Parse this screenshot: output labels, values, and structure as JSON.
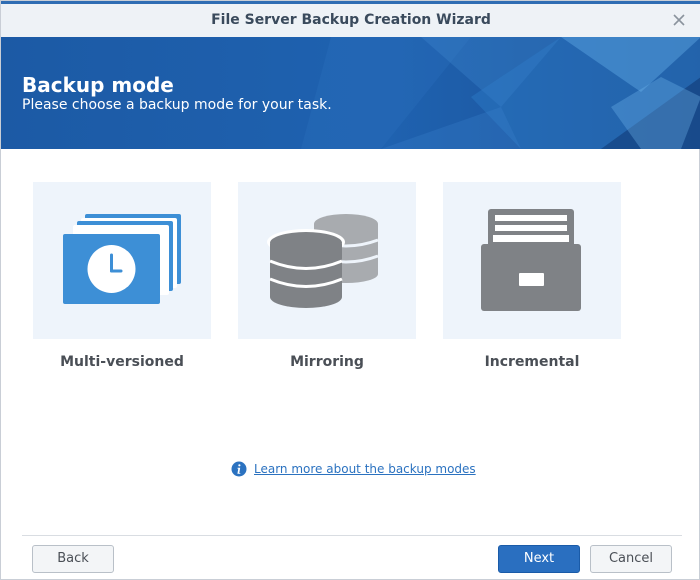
{
  "window": {
    "title": "File Server Backup Creation Wizard",
    "close_icon": "close-icon"
  },
  "header": {
    "title": "Backup mode",
    "subtitle": "Please choose a backup mode for your task."
  },
  "options": [
    {
      "label": "Multi-versioned",
      "icon": "stacked-versions-clock-icon"
    },
    {
      "label": "Mirroring",
      "icon": "database-stack-icon"
    },
    {
      "label": "Incremental",
      "icon": "file-cabinet-icon"
    }
  ],
  "info": {
    "icon": "info-icon",
    "link_text": "Learn more about the backup modes"
  },
  "footer": {
    "back_label": "Back",
    "next_label": "Next",
    "cancel_label": "Cancel"
  },
  "colors": {
    "accent": "#2a6fc0",
    "banner": "#1e5ba6",
    "option_bg": "#eef4fb",
    "icon_blue": "#3d8fd6",
    "icon_gray": "#8a8d91"
  }
}
